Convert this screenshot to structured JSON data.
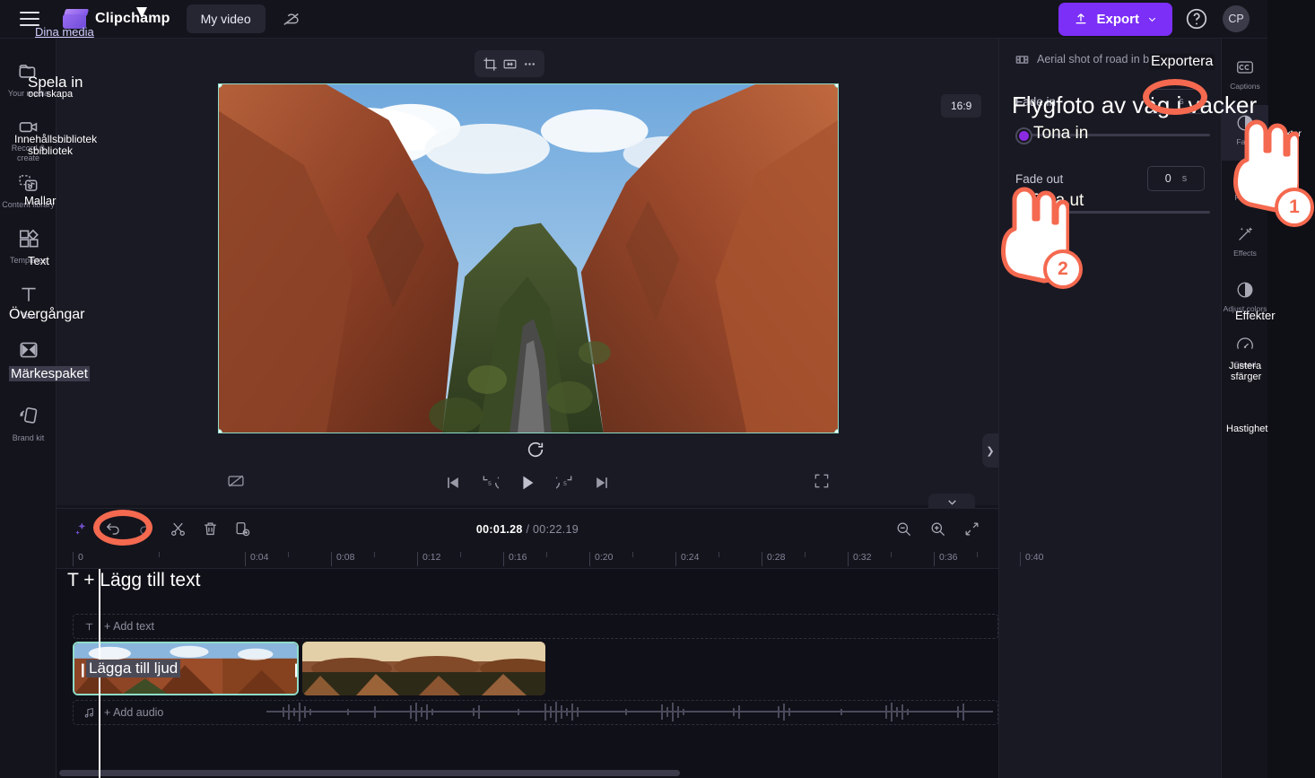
{
  "topbar": {
    "brand": "Clipchamp",
    "project_name": "My video",
    "export_label": "Export",
    "avatar_initials": "CP",
    "icons": {
      "menu": "hamburger-icon",
      "cloud": "cloud-off-icon",
      "help": "help-circle-icon"
    }
  },
  "sidebar": {
    "items": [
      {
        "label": "Your media",
        "icon": "folder-icon"
      },
      {
        "label": "Record & create",
        "icon": "video-camera-icon"
      },
      {
        "label": "Content library",
        "icon": "content-library-icon"
      },
      {
        "label": "Templates",
        "icon": "templates-icon"
      },
      {
        "label": "Text",
        "icon": "text-t-icon"
      },
      {
        "label": "Transitions",
        "icon": "transitions-icon"
      },
      {
        "label": "Brand kit",
        "icon": "brand-kit-icon"
      }
    ]
  },
  "preview": {
    "aspect_ratio": "16:9",
    "float_tools": [
      "crop-icon",
      "fit-icon",
      "more-options-icon"
    ],
    "playback": {
      "captions_off": "captions-off-icon",
      "skip_back": "skip-to-start-icon",
      "back5": "rewind-5s-icon",
      "play": "play-icon",
      "fwd5": "forward-5s-icon",
      "skip_fwd": "skip-to-end-icon",
      "fullscreen": "fullscreen-icon"
    },
    "rotate": "rotate-icon"
  },
  "properties": {
    "clip_title": "Aerial shot of road in be",
    "fade_in": {
      "label": "Fade in",
      "value": "",
      "unit": "s"
    },
    "fade_out": {
      "label": "Fade out",
      "value": "0",
      "unit": "s"
    }
  },
  "rail": {
    "items": [
      {
        "label": "Captions",
        "icon": "closed-captions-icon"
      },
      {
        "label": "Fade",
        "icon": "fade-icon"
      },
      {
        "label": "Filters",
        "icon": "filters-icon"
      },
      {
        "label": "Effects",
        "icon": "magic-wand-icon"
      },
      {
        "label": "Adjust colors",
        "icon": "contrast-circle-icon"
      },
      {
        "label": "Speed",
        "icon": "speedometer-icon"
      }
    ]
  },
  "timeline": {
    "toolbar": {
      "ai": "sparkle-icon",
      "undo": "undo-icon",
      "redo": "redo-icon",
      "split": "scissors-icon",
      "delete": "trash-icon",
      "duplicate": "duplicate-icon",
      "zoom_out": "zoom-out-icon",
      "zoom_in": "zoom-in-icon",
      "fit": "fit-timeline-icon",
      "collapse": "chevron-down-icon"
    },
    "current_time": "00:01.28",
    "separator": " / ",
    "total_time": "00:22.19",
    "ruler_ticks": [
      "0",
      "0:04",
      "0:08",
      "0:12",
      "0:16",
      "0:20",
      "0:24",
      "0:28",
      "0:32",
      "0:36",
      "0:40"
    ],
    "add_text_label": "+ Add text",
    "add_audio_label": "+ Add audio",
    "text_track_icon": "text-t-icon",
    "audio_track_icon": "music-note-icon"
  },
  "annotations": {
    "dina_media": "Dina media",
    "exportera": "Exportera",
    "spela_in": "Spela in",
    "och_skapa": "och skapa",
    "innehallsbibliotek": "Innehållsbibliotek",
    "sbibliotek": "sbibliotek",
    "mallar": "Mallar",
    "text": "Text",
    "overgangar": "Övergångar",
    "markespaket": "Märkespaket",
    "flygfoto": "Flygfoto av väg i vacker",
    "tona_in": "Tona in",
    "tona_ut": "Tona ut",
    "undertexter": "Undertexter",
    "effekter": "Effekter",
    "justera": "Justera",
    "sfarger": "sfärger",
    "hastighet": "Hastighet",
    "lagg_till_text": "T + Lägg till text",
    "lagga_till_ljud": "Lägga till ljud",
    "step1": "1",
    "step2": "2",
    "accent": "#f4694f"
  }
}
